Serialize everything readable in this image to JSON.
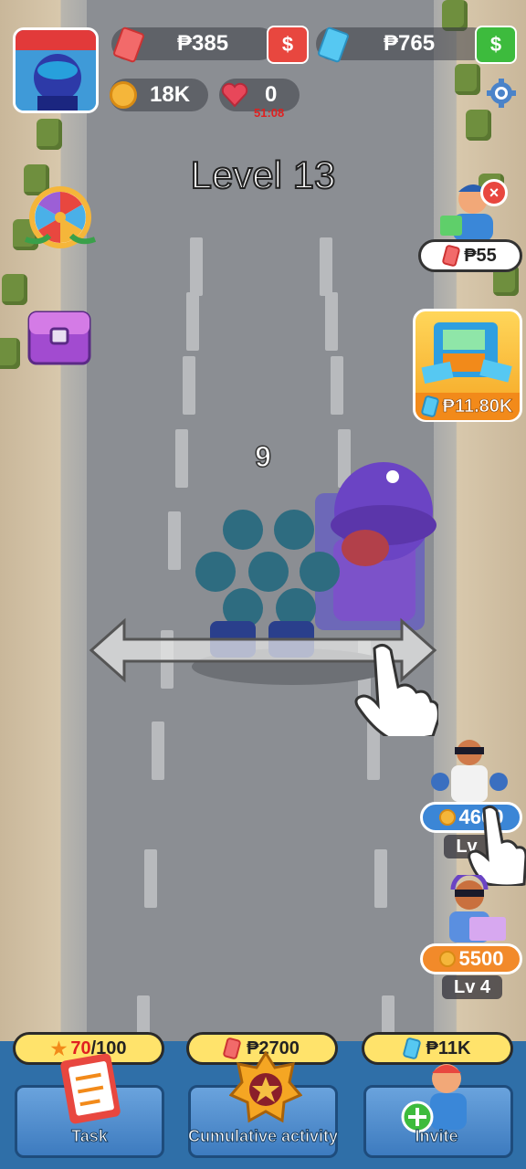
{
  "hud": {
    "red_cash": "₱385",
    "blue_cash": "₱765",
    "coins": "18K",
    "hearts": "0",
    "heart_timer": "51:08",
    "red_add_icon": "cash-plus-icon",
    "blue_add_icon": "cash-plus-icon",
    "colors": {
      "red_add": "#e8473f",
      "blue_add": "#3dbb3d"
    }
  },
  "level_title": "Level 13",
  "crowd_count": "9",
  "side_left": {
    "spin_icon": "prize-wheel-icon",
    "chest_icon": "treasure-chest-icon"
  },
  "side_right": {
    "helper_price": "₱55",
    "atm_price": "₱11.80K",
    "upgrade1": {
      "price": "4600",
      "level": "Lv"
    },
    "upgrade2": {
      "price": "5500",
      "level": "Lv 4"
    },
    "colors": {
      "upgrade1": "#3b86d6",
      "upgrade2": "#f28a2a"
    }
  },
  "bottom": {
    "task": {
      "progress_current": "70",
      "progress_total": "/100",
      "label": "Task"
    },
    "activity": {
      "price": "₱2700",
      "label": "Cumulative activity"
    },
    "invite": {
      "price": "₱11K",
      "label": "Invite"
    }
  }
}
